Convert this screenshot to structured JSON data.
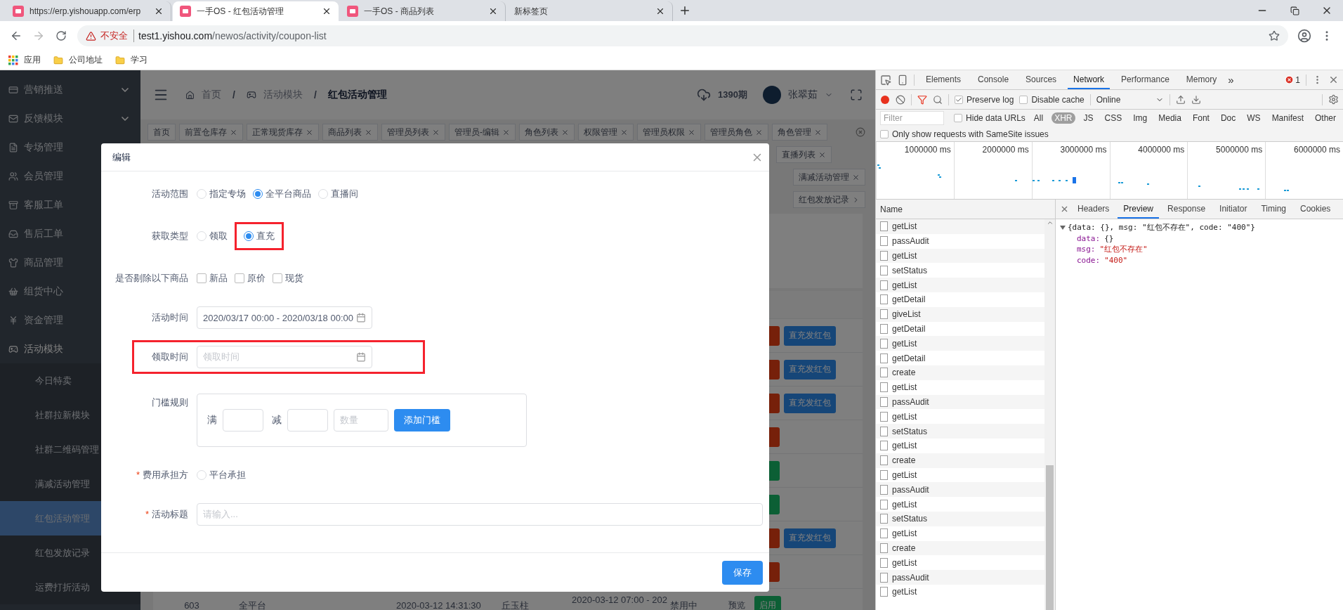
{
  "browser": {
    "tabs": [
      {
        "title": "https://erp.yishouapp.com/erp",
        "selected": false,
        "favicon": true
      },
      {
        "title": "一手OS - 红包活动管理",
        "selected": true,
        "favicon": true
      },
      {
        "title": "一手OS - 商品列表",
        "selected": false,
        "favicon": true
      },
      {
        "title": "新标签页",
        "selected": false,
        "favicon": false
      }
    ],
    "address": {
      "security_label": "不安全",
      "host": "test1.yishou.com",
      "path": "/newos/activity/coupon-list"
    },
    "bookmarks": [
      {
        "kind": "apps",
        "label": "应用"
      },
      {
        "kind": "folder",
        "label": "公司地址"
      },
      {
        "kind": "folder",
        "label": "学习"
      }
    ]
  },
  "sidebar": {
    "items": [
      {
        "label": "营销推送",
        "expandable": true,
        "expanded": false
      },
      {
        "label": "反馈模块",
        "expandable": true,
        "expanded": false
      },
      {
        "label": "专场管理",
        "expandable": false,
        "expanded": false
      },
      {
        "label": "会员管理",
        "expandable": false,
        "expanded": false
      },
      {
        "label": "客服工单",
        "expandable": false,
        "expanded": false
      },
      {
        "label": "售后工单",
        "expandable": false,
        "expanded": false
      },
      {
        "label": "商品管理",
        "expandable": false,
        "expanded": false
      },
      {
        "label": "组货中心",
        "expandable": false,
        "expanded": false
      },
      {
        "label": "资金管理",
        "expandable": false,
        "expanded": false
      },
      {
        "label": "活动模块",
        "expandable": false,
        "expanded": true,
        "children": [
          {
            "label": "今日特卖",
            "selected": false
          },
          {
            "label": "社群拉新模块",
            "selected": false
          },
          {
            "label": "社群二维码管理",
            "selected": false
          },
          {
            "label": "满减活动管理",
            "selected": false
          },
          {
            "label": "红包活动管理",
            "selected": true
          },
          {
            "label": "红包发放记录",
            "selected": false
          },
          {
            "label": "运费打折活动",
            "selected": false
          }
        ]
      }
    ]
  },
  "header": {
    "breadcrumbs": [
      {
        "label": "首页",
        "separator": "/"
      },
      {
        "label": "活动模块",
        "separator": "/"
      },
      {
        "label": "红包活动管理"
      }
    ],
    "period": "1390期",
    "user": "张翠茹"
  },
  "tag_rows": [
    [
      {
        "label": "首页",
        "kind": "plain"
      },
      {
        "label": "前置仓库存",
        "kind": "closable"
      },
      {
        "label": "正常现货库存",
        "kind": "closable"
      },
      {
        "label": "商品列表",
        "kind": "closable"
      },
      {
        "label": "管理员列表",
        "kind": "closable"
      },
      {
        "label": "管理员-编辑",
        "kind": "closable"
      },
      {
        "label": "角色列表",
        "kind": "closable"
      },
      {
        "label": "权限管理",
        "kind": "closable"
      },
      {
        "label": "管理员权限",
        "kind": "closable"
      },
      {
        "label": "管理员角色",
        "kind": "closable"
      },
      {
        "label": "角色管理",
        "kind": "closable"
      }
    ],
    [
      {
        "label": "直播列表",
        "kind": "closable"
      }
    ],
    [
      {
        "label": "满减活动管理",
        "kind": "closable"
      }
    ],
    [
      {
        "label": "红包发放记录",
        "kind": "arrow"
      }
    ]
  ],
  "table": {
    "rows": [
      {
        "actions": [
          {
            "kind": "danger"
          },
          {
            "kind": "primary",
            "label": "直充发红包"
          }
        ]
      },
      {
        "actions": [
          {
            "kind": "danger"
          },
          {
            "kind": "primary",
            "label": "直充发红包"
          }
        ]
      },
      {
        "actions": [
          {
            "kind": "danger"
          },
          {
            "kind": "primary",
            "label": "直充发红包"
          }
        ]
      },
      {
        "actions": [
          {
            "kind": "danger"
          }
        ]
      },
      {
        "actions": [
          {
            "kind": "success"
          }
        ]
      },
      {
        "actions": [
          {
            "kind": "success"
          }
        ]
      },
      {
        "actions": [
          {
            "kind": "danger"
          },
          {
            "kind": "primary",
            "label": "直充发红包"
          }
        ]
      },
      {
        "actions": [
          {
            "kind": "danger"
          }
        ]
      },
      {
        "cells": [
          "603",
          "全平台",
          "2020-03-12 14:31:30",
          "丘玉柱",
          "2020-03-12 07:00 - 202",
          "禁用中"
        ],
        "actions": [
          {
            "kind": "link",
            "label": "预览"
          },
          {
            "kind": "success",
            "label": "启用"
          }
        ]
      }
    ]
  },
  "modal": {
    "title": "编辑",
    "fields": [
      {
        "kind": "radio",
        "label": "活动范围",
        "highlighted": false,
        "options": [
          {
            "label": "指定专场",
            "selected": false,
            "highlighted": false
          },
          {
            "label": "全平台商品",
            "selected": true,
            "highlighted": false
          },
          {
            "label": "直播间",
            "selected": false,
            "highlighted": false
          }
        ]
      },
      {
        "kind": "radio",
        "label": "获取类型",
        "highlighted": false,
        "options": [
          {
            "label": "领取",
            "selected": false,
            "highlighted": false
          },
          {
            "label": "直充",
            "selected": true,
            "highlighted": true
          }
        ]
      },
      {
        "kind": "checkbox",
        "label": "是否剔除以下商品",
        "highlighted": false,
        "options": [
          {
            "label": "新品",
            "checked": false
          },
          {
            "label": "原价",
            "checked": false
          },
          {
            "label": "现货",
            "checked": false
          }
        ]
      },
      {
        "kind": "date",
        "label": "活动时间",
        "highlighted": false,
        "value": "2020/03/17 00:00 - 2020/03/18 00:00"
      },
      {
        "kind": "date",
        "label": "领取时间",
        "highlighted": true,
        "placeholder": "领取时间"
      },
      {
        "kind": "threshold",
        "label": "门槛规则",
        "highlighted": false,
        "full_label": "满",
        "minus_label": "减",
        "count_placeholder": "数量",
        "add_button": "添加门槛"
      },
      {
        "kind": "radio",
        "label": "费用承担方",
        "required_mark": "*",
        "highlighted": false,
        "options": [
          {
            "label": "平台承担",
            "selected": false,
            "highlighted": false
          }
        ]
      },
      {
        "kind": "text",
        "label": "活动标题",
        "required_mark": "*",
        "highlighted": false,
        "placeholder": "请输入..."
      }
    ],
    "save_button": "保存"
  },
  "devtools": {
    "tabs": [
      {
        "label": "Elements",
        "selected": false
      },
      {
        "label": "Console",
        "selected": false
      },
      {
        "label": "Sources",
        "selected": false
      },
      {
        "label": "Network",
        "selected": true
      },
      {
        "label": "Performance",
        "selected": false
      },
      {
        "label": "Memory",
        "selected": false
      }
    ],
    "overflow": "»",
    "error_count": "1",
    "checkboxes": [
      {
        "label": "Preserve log",
        "checked": true
      },
      {
        "label": "Disable cache",
        "checked": false
      }
    ],
    "throttle": "Online",
    "filter": {
      "placeholder": "Filter",
      "hide_data_urls": {
        "label": "Hide data URLs",
        "checked": false
      },
      "types": [
        {
          "label": "All",
          "selected": false
        },
        {
          "label": "XHR",
          "selected": true
        },
        {
          "label": "JS",
          "selected": false
        },
        {
          "label": "CSS",
          "selected": false
        },
        {
          "label": "Img",
          "selected": false
        },
        {
          "label": "Media",
          "selected": false
        },
        {
          "label": "Font",
          "selected": false
        },
        {
          "label": "Doc",
          "selected": false
        },
        {
          "label": "WS",
          "selected": false
        },
        {
          "label": "Manifest",
          "selected": false
        },
        {
          "label": "Other",
          "selected": false
        }
      ]
    },
    "samesite": {
      "label": "Only show requests with SameSite issues",
      "checked": false
    },
    "timeline": {
      "ticks": [
        "1000000 ms",
        "2000000 ms",
        "3000000 ms",
        "4000000 ms",
        "5000000 ms",
        "6000000 ms"
      ]
    },
    "requests": {
      "header": "Name",
      "rows": [
        "getList",
        "passAudit",
        "getList",
        "setStatus",
        "getList",
        "getDetail",
        "giveList",
        "getDetail",
        "getList",
        "getDetail",
        "create",
        "getList",
        "passAudit",
        "getList",
        "setStatus",
        "getList",
        "create",
        "getList",
        "passAudit",
        "getList",
        "setStatus",
        "getList",
        "create",
        "getList",
        "passAudit",
        "getList"
      ]
    },
    "details": {
      "tabs": [
        {
          "label": "Headers",
          "selected": false
        },
        {
          "label": "Preview",
          "selected": true
        },
        {
          "label": "Response",
          "selected": false
        },
        {
          "label": "Initiator",
          "selected": false
        },
        {
          "label": "Timing",
          "selected": false
        },
        {
          "label": "Cookies",
          "selected": false
        }
      ],
      "preview": {
        "summary": "{data: {}, msg: \"红包不存在\", code: \"400\"}",
        "expanded": true,
        "lines": [
          {
            "key": "data:",
            "value": "{}",
            "kind": "object"
          },
          {
            "key": "msg:",
            "value": "\"红包不存在\"",
            "kind": "string"
          },
          {
            "key": "code:",
            "value": "\"400\"",
            "kind": "string"
          }
        ]
      }
    }
  }
}
